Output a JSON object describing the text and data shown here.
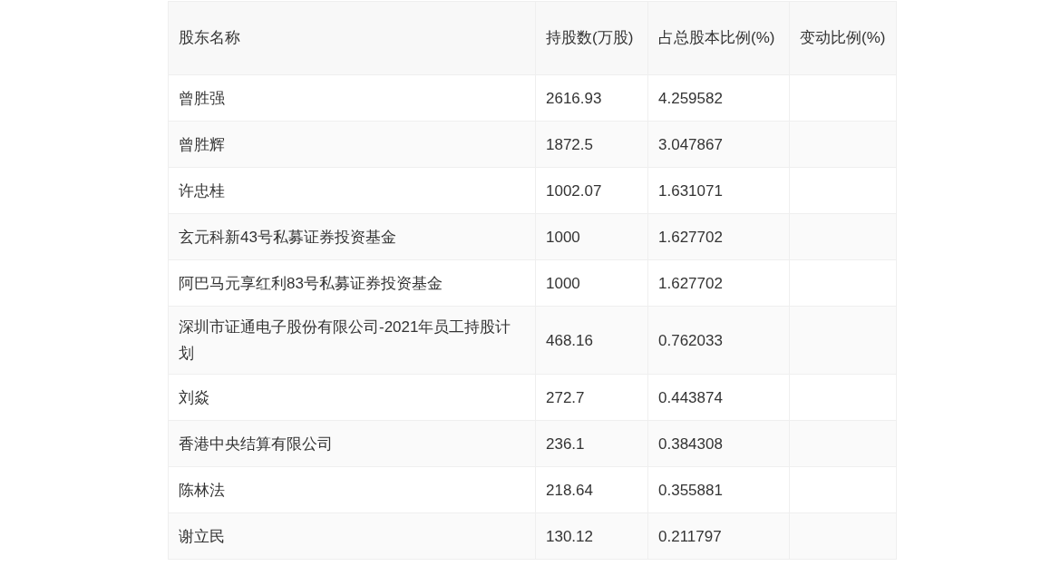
{
  "table": {
    "columns": [
      "股东名称",
      "持股数(万股)",
      "占总股本比例(%)",
      "变动比例(%)"
    ],
    "rows": [
      {
        "name": "曾胜强",
        "shares": "2616.93",
        "ratio": "4.259582"
      },
      {
        "name": "曾胜辉",
        "shares": "1872.5",
        "ratio": "3.047867"
      },
      {
        "name": "许忠桂",
        "shares": "1002.07",
        "ratio": "1.631071"
      },
      {
        "name": "玄元科新43号私募证券投资基金",
        "shares": "1000",
        "ratio": "1.627702"
      },
      {
        "name": "阿巴马元享红利83号私募证券投资基金",
        "shares": "1000",
        "ratio": "1.627702"
      },
      {
        "name": "深圳市证通电子股份有限公司-2021年员工持股计划",
        "shares": "468.16",
        "ratio": "0.762033"
      },
      {
        "name": "刘焱",
        "shares": "272.7",
        "ratio": "0.443874"
      },
      {
        "name": "香港中央结算有限公司",
        "shares": "236.1",
        "ratio": "0.384308"
      },
      {
        "name": "陈林法",
        "shares": "218.64",
        "ratio": "0.355881"
      },
      {
        "name": "谢立民",
        "shares": "130.12",
        "ratio": "0.211797"
      }
    ]
  }
}
